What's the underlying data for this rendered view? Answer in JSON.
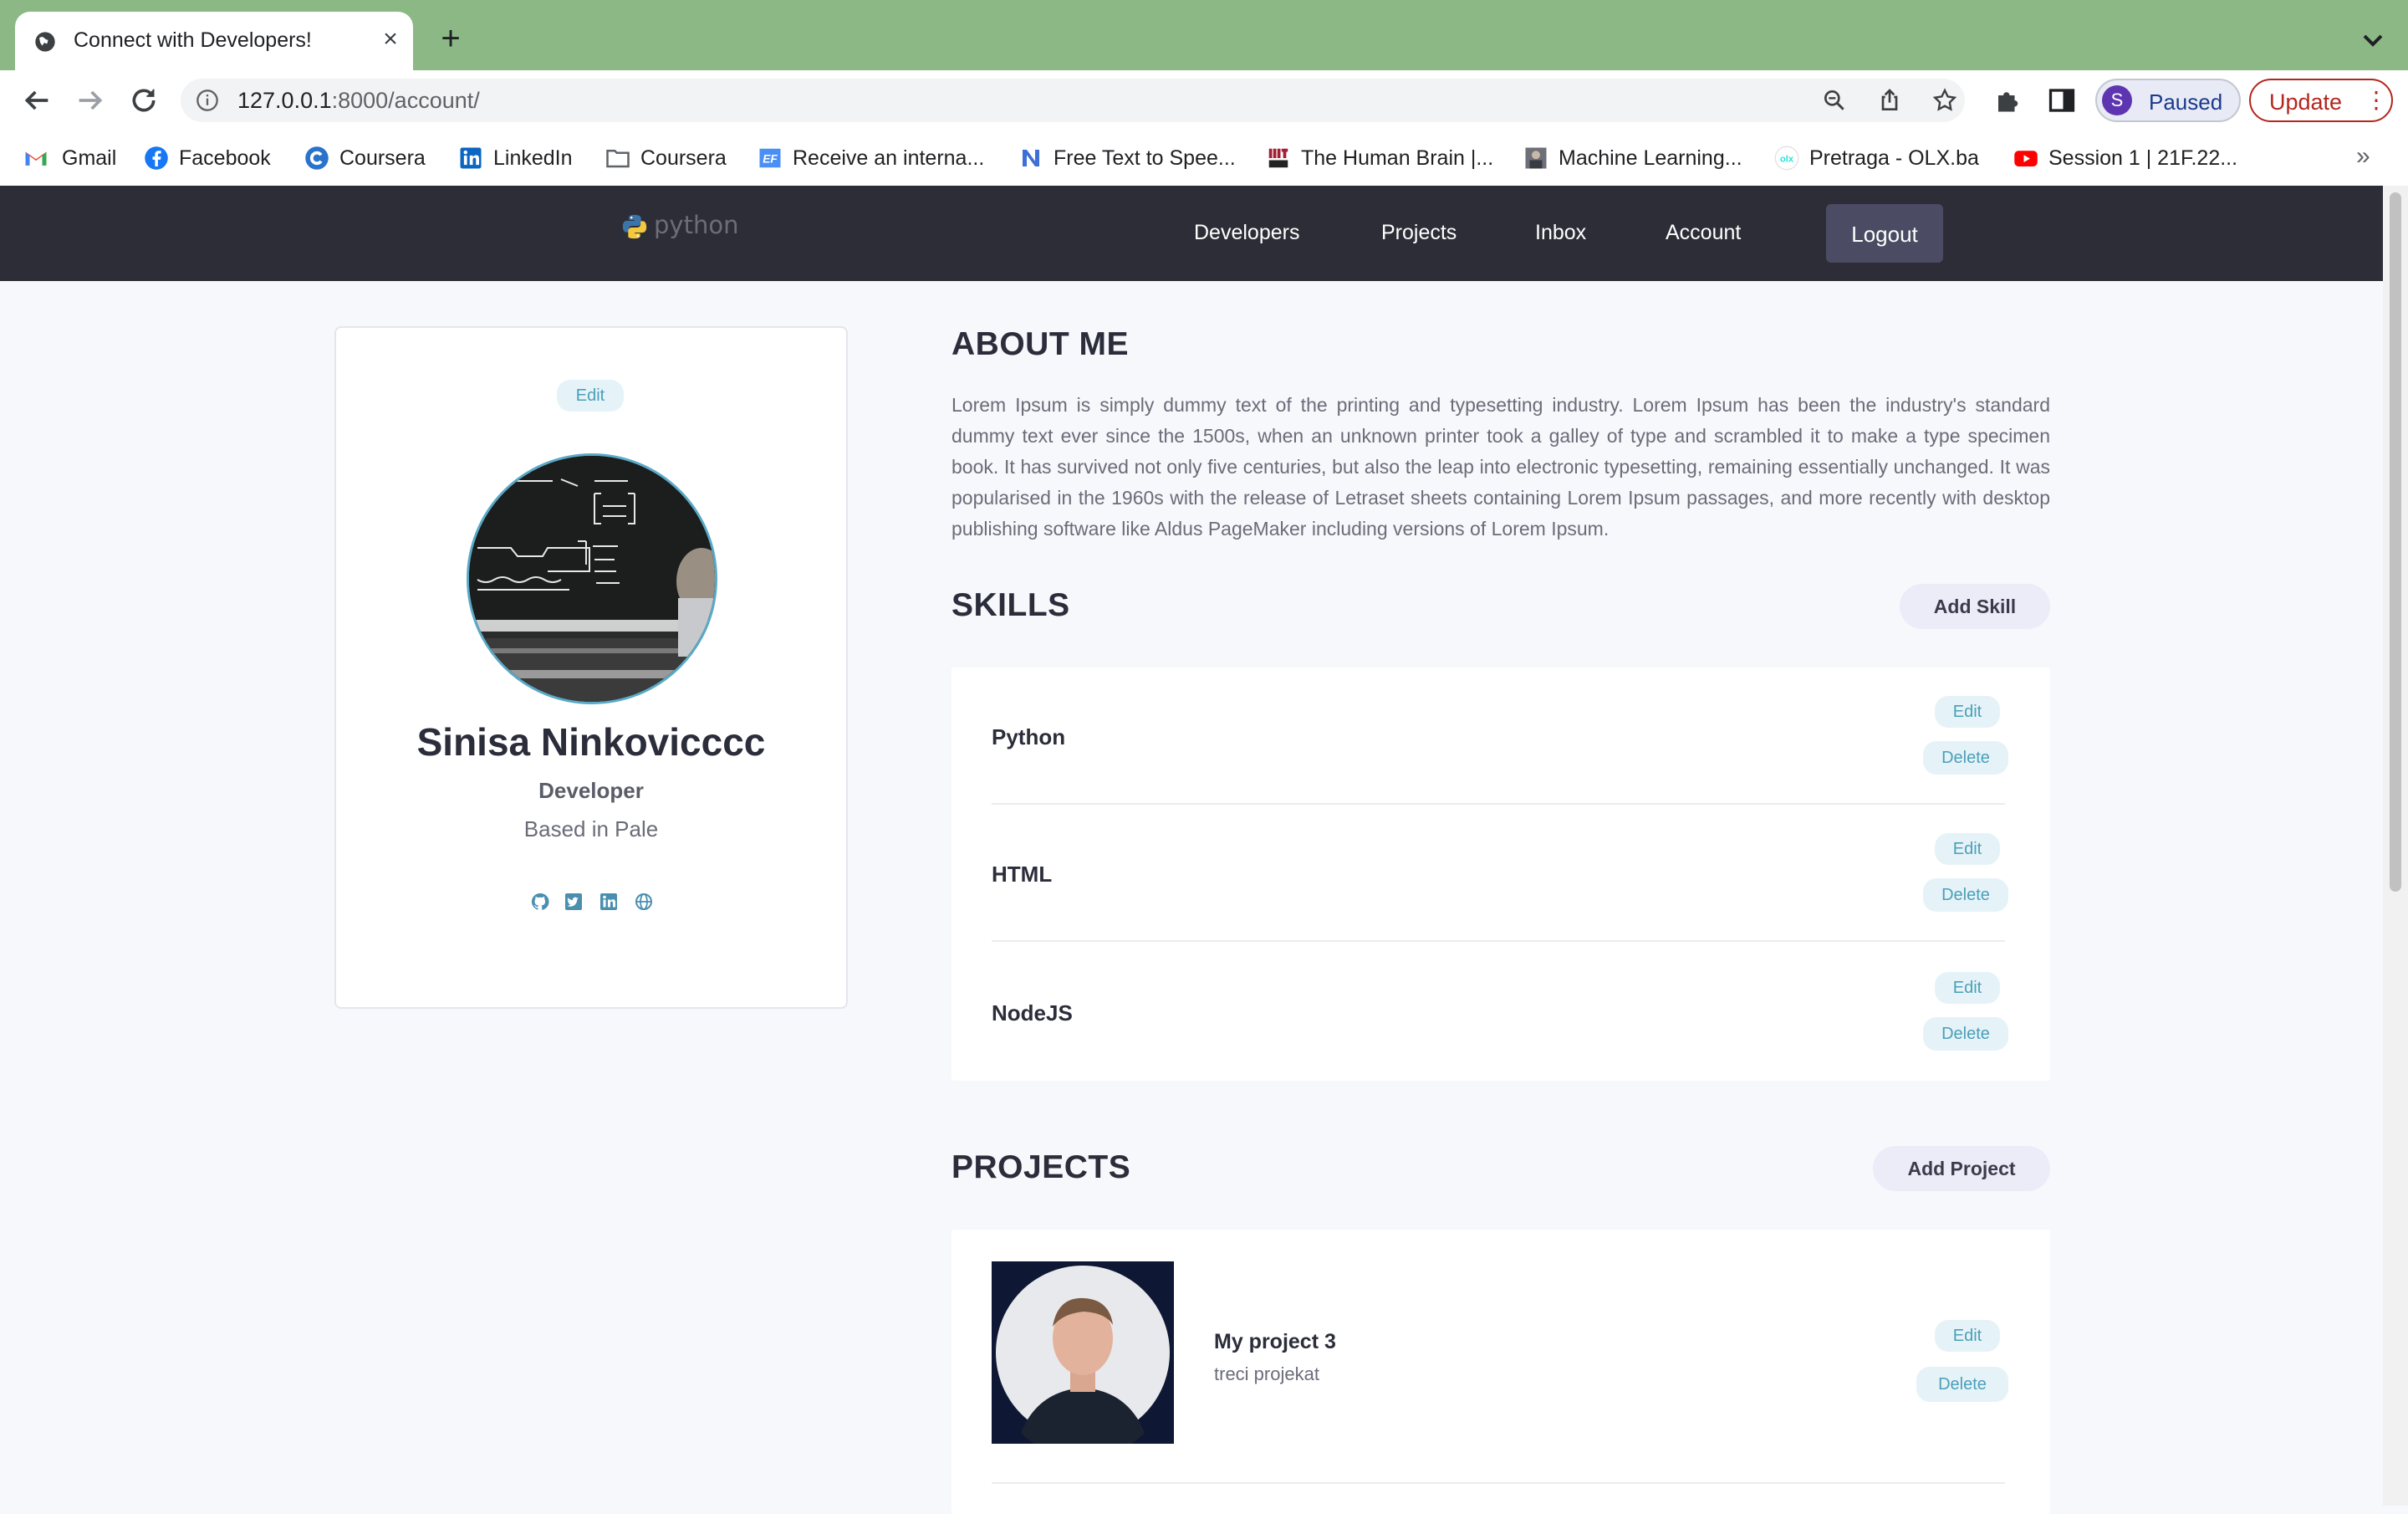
{
  "browser": {
    "tab_title": "Connect with Developers!",
    "url_host": "127.0.0.1",
    "url_rest": ":8000/account/",
    "profile_initial": "S",
    "profile_label": "Paused",
    "update_label": "Update",
    "bookmarks": [
      {
        "label": "Gmail",
        "icon": "gmail-icon"
      },
      {
        "label": "Facebook",
        "icon": "facebook-icon"
      },
      {
        "label": "Coursera",
        "icon": "coursera-icon"
      },
      {
        "label": "LinkedIn",
        "icon": "linkedin-icon"
      },
      {
        "label": "Coursera",
        "icon": "folder-icon"
      },
      {
        "label": "Receive an interna...",
        "icon": "ef-icon"
      },
      {
        "label": "Free Text to Spee...",
        "icon": "n-icon"
      },
      {
        "label": "The Human Brain |...",
        "icon": "mit-ocw-icon"
      },
      {
        "label": "Machine Learning...",
        "icon": "thumbnail-icon"
      },
      {
        "label": "Pretraga - OLX.ba",
        "icon": "olx-icon"
      },
      {
        "label": "Session 1 | 21F.22...",
        "icon": "youtube-icon"
      }
    ],
    "more_bookmarks": "»"
  },
  "navbar": {
    "logo_text": "python",
    "links": [
      "Developers",
      "Projects",
      "Inbox",
      "Account"
    ],
    "logout": "Logout"
  },
  "profile": {
    "edit_label": "Edit",
    "name": "Sinisa Ninkovicccc",
    "role": "Developer",
    "location": "Based in Pale",
    "social_icons": [
      "github-icon",
      "twitter-icon",
      "linkedin-icon",
      "website-icon"
    ]
  },
  "about": {
    "heading": "ABOUT ME",
    "text": "Lorem Ipsum is simply dummy text of the printing and typesetting industry. Lorem Ipsum has been the industry's standard dummy text ever since the 1500s, when an unknown printer took a galley of type and scrambled it to make a type specimen book. It has survived not only five centuries, but also the leap into electronic typesetting, remaining essentially unchanged. It was popularised in the 1960s with the release of Letraset sheets containing Lorem Ipsum passages, and more recently with desktop publishing software like Aldus PageMaker including versions of Lorem Ipsum."
  },
  "skills": {
    "heading": "SKILLS",
    "add_label": "Add Skill",
    "edit_label": "Edit",
    "delete_label": "Delete",
    "items": [
      "Python",
      "HTML",
      "NodeJS"
    ]
  },
  "projects": {
    "heading": "PROJECTS",
    "add_label": "Add Project",
    "edit_label": "Edit",
    "delete_label": "Delete",
    "items": [
      {
        "title": "My project 3",
        "description": "treci projekat"
      }
    ]
  },
  "colors": {
    "chrome_frame": "#8cb886",
    "navbar": "#2d2d37",
    "chip_bg": "#e5f3f8",
    "chip_text": "#4a9fb8",
    "accent_ring": "#5aa9c7"
  }
}
